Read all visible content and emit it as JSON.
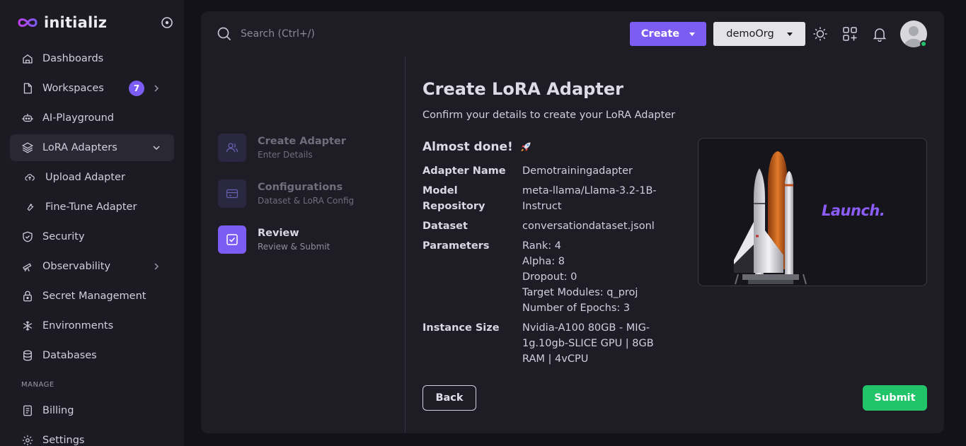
{
  "app": {
    "name": "initializ"
  },
  "sidebar": {
    "items": [
      {
        "label": "Dashboards",
        "icon": "home-icon"
      },
      {
        "label": "Workspaces",
        "icon": "file-icon",
        "badge": "7"
      },
      {
        "label": "AI-Playground",
        "icon": "robot-icon"
      },
      {
        "label": "LoRA Adapters",
        "icon": "layers-icon",
        "active": true
      },
      {
        "label": "Upload Adapter",
        "icon": "cloud-upload-icon"
      },
      {
        "label": "Fine-Tune Adapter",
        "icon": "wrench-icon"
      },
      {
        "label": "Security",
        "icon": "shield-icon"
      },
      {
        "label": "Observability",
        "icon": "telescope-icon"
      },
      {
        "label": "Secret Management",
        "icon": "lock-icon"
      },
      {
        "label": "Environments",
        "icon": "snowflake-icon"
      },
      {
        "label": "Databases",
        "icon": "database-icon"
      }
    ],
    "manage_label": "MANAGE",
    "manage_items": [
      {
        "label": "Billing",
        "icon": "receipt-icon"
      },
      {
        "label": "Settings",
        "icon": "gear-icon"
      }
    ]
  },
  "topbar": {
    "search_placeholder": "Search (Ctrl+/)",
    "create_label": "Create",
    "org_label": "demoOrg"
  },
  "stepper": [
    {
      "title": "Create Adapter",
      "subtitle": "Enter Details"
    },
    {
      "title": "Configurations",
      "subtitle": "Dataset & LoRA Config"
    },
    {
      "title": "Review",
      "subtitle": "Review & Submit",
      "active": true
    }
  ],
  "main": {
    "title": "Create LoRA Adapter",
    "subtitle": "Confirm your details to create your LoRA Adapter",
    "almost_done": "Almost done!",
    "details": [
      {
        "label": "Adapter Name",
        "value": "Demotrainingadapter"
      },
      {
        "label": "Model Repository",
        "value": "meta-llama/Llama-3.2-1B-Instruct"
      },
      {
        "label": "Dataset",
        "value": "conversationdataset.jsonl"
      },
      {
        "label": "Parameters",
        "lines": [
          "Rank: 4",
          "Alpha: 8",
          "Dropout: 0",
          "Target Modules: q_proj",
          "Number of Epochs: 3"
        ]
      },
      {
        "label": "Instance Size",
        "value": "Nvidia-A100 80GB - MIG-1g.10gb-SLICE GPU | 8GB RAM | 4vCPU"
      }
    ],
    "launch_text": "Launch.",
    "back_label": "Back",
    "submit_label": "Submit"
  },
  "colors": {
    "accent": "#7c5cf2",
    "success": "#22c46a",
    "sidebar_bg": "#1c1b23",
    "card_bg": "#1e1d26"
  }
}
